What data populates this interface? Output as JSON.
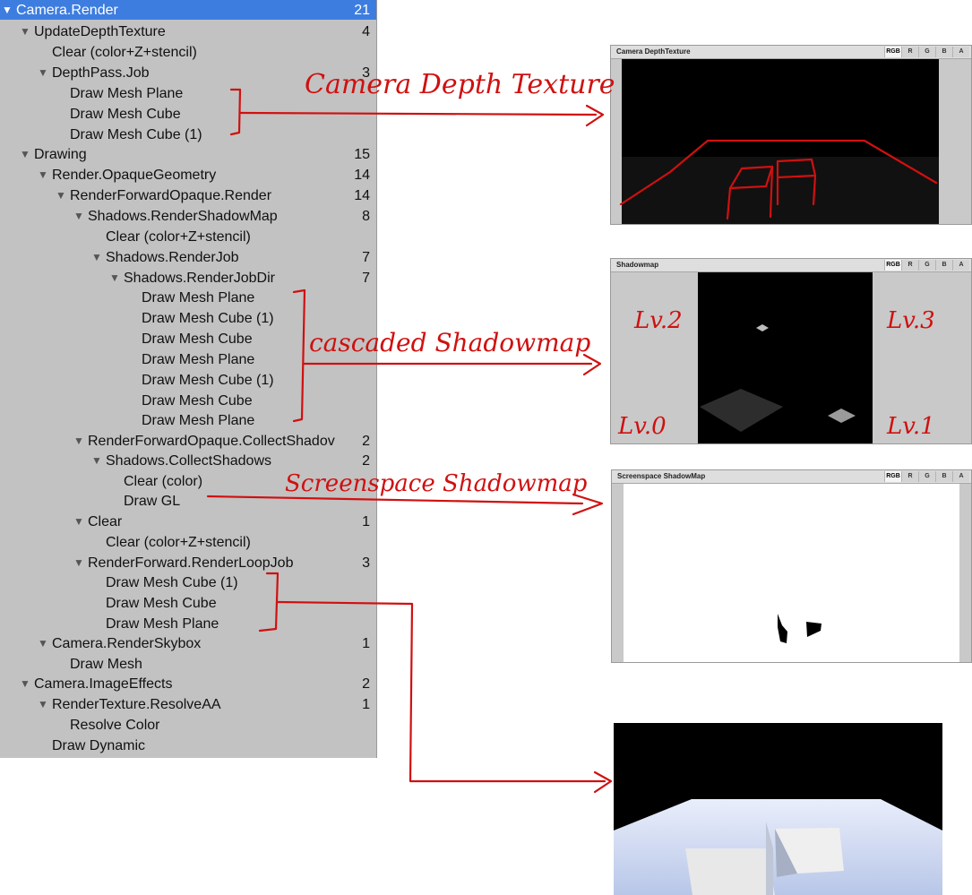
{
  "tree": {
    "rows": [
      {
        "label": "Camera.Render",
        "count": "21",
        "expanded": true
      },
      {
        "label": "UpdateDepthTexture",
        "count": "4",
        "expanded": true
      },
      {
        "label": "Clear (color+Z+stencil)",
        "count": ""
      },
      {
        "label": "DepthPass.Job",
        "count": "3",
        "expanded": true
      },
      {
        "label": "Draw Mesh Plane",
        "count": ""
      },
      {
        "label": "Draw Mesh Cube",
        "count": ""
      },
      {
        "label": "Draw Mesh Cube (1)",
        "count": ""
      },
      {
        "label": "Drawing",
        "count": "15",
        "expanded": true
      },
      {
        "label": "Render.OpaqueGeometry",
        "count": "14",
        "expanded": true
      },
      {
        "label": "RenderForwardOpaque.Render",
        "count": "14",
        "expanded": true
      },
      {
        "label": "Shadows.RenderShadowMap",
        "count": "8",
        "expanded": true
      },
      {
        "label": "Clear (color+Z+stencil)",
        "count": ""
      },
      {
        "label": "Shadows.RenderJob",
        "count": "7",
        "expanded": true
      },
      {
        "label": "Shadows.RenderJobDir",
        "count": "7",
        "expanded": true
      },
      {
        "label": "Draw Mesh Plane",
        "count": ""
      },
      {
        "label": "Draw Mesh Cube (1)",
        "count": ""
      },
      {
        "label": "Draw Mesh Cube",
        "count": ""
      },
      {
        "label": "Draw Mesh Plane",
        "count": ""
      },
      {
        "label": "Draw Mesh Cube (1)",
        "count": ""
      },
      {
        "label": "Draw Mesh Cube",
        "count": ""
      },
      {
        "label": "Draw Mesh Plane",
        "count": ""
      },
      {
        "label": "RenderForwardOpaque.CollectShadov",
        "count": "2",
        "expanded": true
      },
      {
        "label": "Shadows.CollectShadows",
        "count": "2",
        "expanded": true
      },
      {
        "label": "Clear (color)",
        "count": ""
      },
      {
        "label": "Draw GL",
        "count": ""
      },
      {
        "label": "Clear",
        "count": "1",
        "expanded": true
      },
      {
        "label": "Clear (color+Z+stencil)",
        "count": ""
      },
      {
        "label": "RenderForward.RenderLoopJob",
        "count": "3",
        "expanded": true
      },
      {
        "label": "Draw Mesh Cube (1)",
        "count": ""
      },
      {
        "label": "Draw Mesh Cube",
        "count": ""
      },
      {
        "label": "Draw Mesh Plane",
        "count": ""
      },
      {
        "label": "Camera.RenderSkybox",
        "count": "1",
        "expanded": true
      },
      {
        "label": "Draw Mesh",
        "count": ""
      },
      {
        "label": "Camera.ImageEffects",
        "count": "2",
        "expanded": true
      },
      {
        "label": "RenderTexture.ResolveAA",
        "count": "1",
        "expanded": true
      },
      {
        "label": "Resolve Color",
        "count": ""
      },
      {
        "label": "Draw Dynamic",
        "count": ""
      }
    ]
  },
  "channels": [
    "RGB",
    "R",
    "G",
    "B",
    "A"
  ],
  "panels": {
    "depth": {
      "title": "Camera DepthTexture"
    },
    "shadowmap": {
      "title": "Shadowmap"
    },
    "screenspace": {
      "title": "Screenspace ShadowMap"
    }
  },
  "annotations": {
    "depth": "Camera Depth Texture",
    "cascaded": "cascaded Shadowmap",
    "screenspace": "Screenspace Shadowmap",
    "lv0": "Lv.0",
    "lv1": "Lv.1",
    "lv2": "Lv.2",
    "lv3": "Lv.3"
  },
  "colors": {
    "selection": "#3d7de0",
    "annotation": "#d01010",
    "panel_bg": "#c2c2c2"
  }
}
